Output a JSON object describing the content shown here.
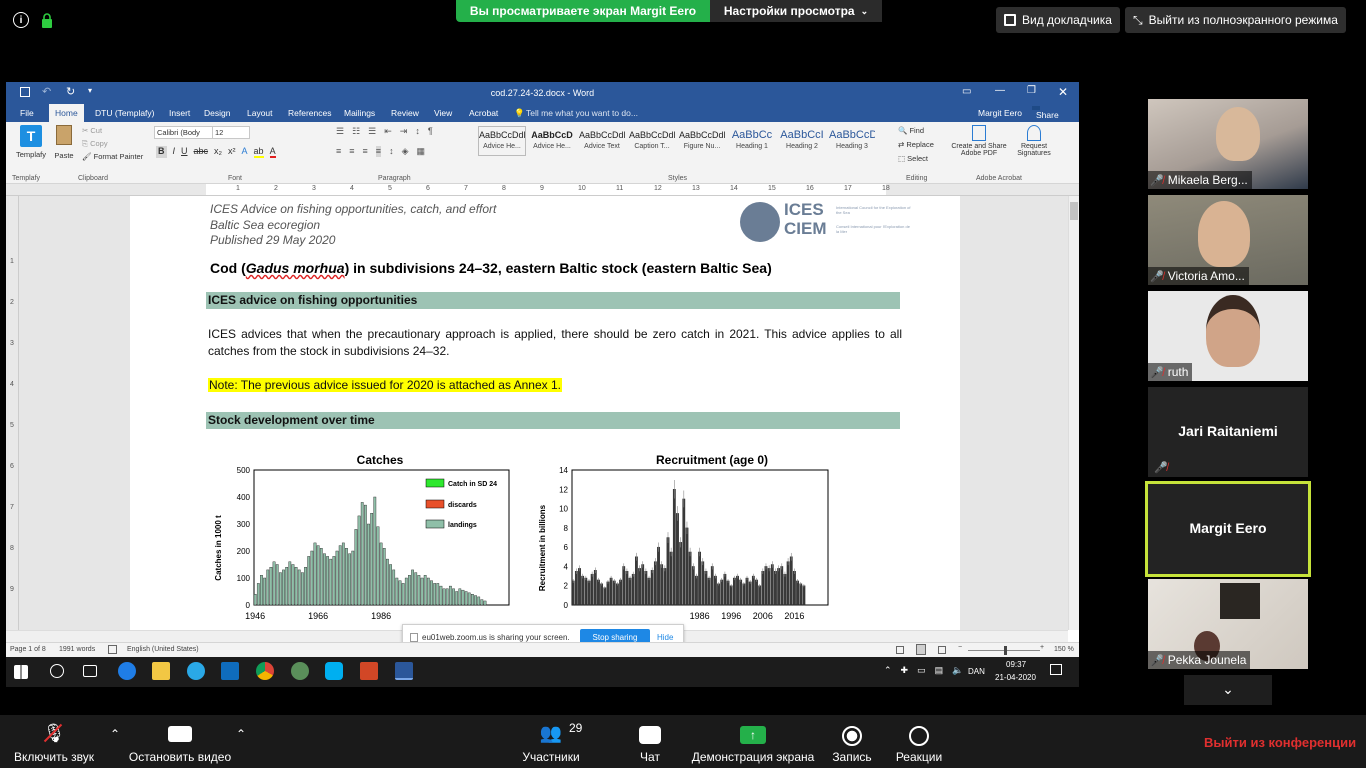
{
  "zoom_top": {
    "share_banner": "Вы просматриваете экран Margit Eero",
    "view_settings": "Настройки просмотра",
    "speaker_view": "Вид докладчика",
    "exit_fullscreen": "Выйти из полноэкранного режима"
  },
  "word": {
    "title": "cod.27.24-32.docx - Word",
    "user": "Margit Eero",
    "share": "Share",
    "tabs": [
      "File",
      "Home",
      "DTU (Templafy)",
      "Insert",
      "Design",
      "Layout",
      "References",
      "Mailings",
      "Review",
      "View",
      "Acrobat"
    ],
    "tell_me": "Tell me what you want to do...",
    "ribbon": {
      "templafy_label": "Templafy",
      "templafy_group": "Templafy",
      "paste": "Paste",
      "cut": "Cut",
      "copy": "Copy",
      "format_painter": "Format Painter",
      "clipboard_group": "Clipboard",
      "font_name": "Calibri (Body",
      "font_size": "12",
      "font_group": "Font",
      "paragraph_group": "Paragraph",
      "styles_group": "Styles",
      "styles": [
        {
          "sample": "AaBbCcDdEe",
          "name": "Advice He..."
        },
        {
          "sample": "AaBbCcD",
          "name": "Advice He..."
        },
        {
          "sample": "AaBbCcDdE",
          "name": "Advice Text"
        },
        {
          "sample": "AaBbCcDdEe",
          "name": "Caption T..."
        },
        {
          "sample": "AaBbCcDdEe",
          "name": "Figure Nu..."
        },
        {
          "sample": "AaBbCc",
          "name": "Heading 1"
        },
        {
          "sample": "AaBbCcI",
          "name": "Heading 2"
        },
        {
          "sample": "AaBbCcD",
          "name": "Heading 3"
        }
      ],
      "find": "Find",
      "replace": "Replace",
      "select": "Select",
      "editing_group": "Editing",
      "create_pdf": "Create and Share Adobe PDF",
      "request_sig": "Request Signatures",
      "acrobat_group": "Adobe Acrobat"
    },
    "ruler_numbers": [
      "1",
      "2",
      "3",
      "4",
      "5",
      "6",
      "7",
      "8",
      "9",
      "10",
      "11",
      "12",
      "13",
      "14",
      "15",
      "16",
      "17",
      "18"
    ],
    "vruler_numbers": [
      "1",
      "2",
      "3",
      "4",
      "5",
      "6",
      "7",
      "8",
      "9"
    ],
    "doc": {
      "header1": "ICES Advice on fishing opportunities, catch, and effort",
      "header2": "Baltic Sea ecoregion",
      "header3": "Published 29 May 2020",
      "logo_text": "ICES",
      "logo_text2": "CIEM",
      "logo_sub1": "International Council for the Exploration of the Sea",
      "logo_sub2": "Conseil International pour l'Exploration de la Mer",
      "title_pre": "Cod (",
      "title_italic": "Gadus morhua",
      "title_post": ") in subdivisions 24–32, eastern Baltic stock (eastern Baltic Sea)",
      "section1": "ICES advice on fishing opportunities",
      "advice": "ICES advices that when the precautionary approach is applied, there should be zero catch in 2021. This advice applies to all catches from the stock in subdivisions 24–32.",
      "note": "Note: The previous advice issued for 2020 is attached as Annex 1.",
      "section2": "Stock development over time"
    },
    "charts": [
      {
        "type": "bar",
        "title": "Catches",
        "ylabel": "Catches in 1000 t",
        "yticks": [
          "0",
          "100",
          "200",
          "300",
          "400",
          "500"
        ],
        "ylim": [
          0,
          500
        ],
        "xticks": [
          "1946",
          "1966",
          "1986"
        ],
        "legend": [
          "Catch in SD 24",
          "discards",
          "landings"
        ],
        "legend_colors": [
          "#2ee82e",
          "#e8502a",
          "#8fbfa8"
        ],
        "x": [
          1946,
          1947,
          1948,
          1949,
          1950,
          1951,
          1952,
          1953,
          1954,
          1955,
          1956,
          1957,
          1958,
          1959,
          1960,
          1961,
          1962,
          1963,
          1964,
          1965,
          1966,
          1967,
          1968,
          1969,
          1970,
          1971,
          1972,
          1973,
          1974,
          1975,
          1976,
          1977,
          1978,
          1979,
          1980,
          1981,
          1982,
          1983,
          1984,
          1985,
          1986,
          1987,
          1988,
          1989,
          1990,
          1991,
          1992,
          1993,
          1994,
          1995,
          1996,
          1997,
          1998,
          1999,
          2000,
          2001,
          2002,
          2003,
          2004,
          2005,
          2006,
          2007,
          2008,
          2009,
          2010,
          2011,
          2012,
          2013,
          2014,
          2015,
          2016,
          2017,
          2018,
          2019
        ],
        "values": [
          40,
          80,
          110,
          100,
          130,
          140,
          160,
          150,
          120,
          130,
          140,
          160,
          150,
          140,
          130,
          120,
          140,
          180,
          200,
          230,
          220,
          210,
          190,
          180,
          170,
          180,
          200,
          220,
          230,
          210,
          190,
          200,
          280,
          330,
          380,
          370,
          300,
          340,
          400,
          290,
          230,
          210,
          170,
          150,
          130,
          100,
          90,
          80,
          100,
          110,
          130,
          120,
          110,
          100,
          110,
          100,
          90,
          80,
          80,
          70,
          60,
          60,
          70,
          60,
          50,
          60,
          55,
          50,
          45,
          40,
          35,
          30,
          20,
          15
        ]
      },
      {
        "type": "bar",
        "title": "Recruitment (age 0)",
        "ylabel": "Recruitment in billions",
        "yticks": [
          "0",
          "2",
          "4",
          "6",
          "8",
          "10",
          "12",
          "14"
        ],
        "ylim": [
          0,
          14
        ],
        "xticks": [
          "1986",
          "1996",
          "2006",
          "2016"
        ],
        "x": [
          1946,
          1947,
          1948,
          1949,
          1950,
          1951,
          1952,
          1953,
          1954,
          1955,
          1956,
          1957,
          1958,
          1959,
          1960,
          1961,
          1962,
          1963,
          1964,
          1965,
          1966,
          1967,
          1968,
          1969,
          1970,
          1971,
          1972,
          1973,
          1974,
          1975,
          1976,
          1977,
          1978,
          1979,
          1980,
          1981,
          1982,
          1983,
          1984,
          1985,
          1986,
          1987,
          1988,
          1989,
          1990,
          1991,
          1992,
          1993,
          1994,
          1995,
          1996,
          1997,
          1998,
          1999,
          2000,
          2001,
          2002,
          2003,
          2004,
          2005,
          2006,
          2007,
          2008,
          2009,
          2010,
          2011,
          2012,
          2013,
          2014,
          2015,
          2016,
          2017,
          2018,
          2019
        ],
        "values": [
          2.5,
          3.5,
          3.8,
          3.0,
          2.8,
          2.5,
          3.2,
          3.6,
          2.6,
          2.2,
          1.8,
          2.4,
          2.8,
          2.5,
          2.2,
          2.6,
          4.0,
          3.5,
          2.8,
          3.2,
          5.0,
          3.8,
          4.2,
          3.5,
          2.8,
          3.6,
          4.5,
          6.0,
          4.2,
          3.8,
          7.0,
          5.5,
          12.0,
          9.5,
          6.5,
          11.0,
          8.0,
          5.5,
          4.0,
          3.0,
          5.5,
          4.5,
          3.5,
          2.8,
          4.0,
          3.0,
          2.2,
          2.6,
          3.2,
          2.5,
          2.0,
          2.8,
          3.0,
          2.6,
          2.2,
          2.8,
          2.4,
          3.0,
          2.6,
          2.0,
          3.5,
          4.0,
          3.8,
          4.2,
          3.5,
          3.8,
          4.0,
          3.2,
          4.5,
          5.0,
          3.5,
          2.5,
          2.2,
          2.0
        ]
      }
    ],
    "status": {
      "page": "Page 1 of 8",
      "words": "1991 words",
      "lang": "English (United States)",
      "zoom": "150 %"
    },
    "zoom_share": {
      "text": "eu01web.zoom.us is sharing your screen.",
      "stop": "Stop sharing",
      "hide": "Hide"
    }
  },
  "taskbar": {
    "lang": "DAN",
    "time": "09:37",
    "date": "21-04-2020"
  },
  "participants_panel": [
    {
      "name": "Mikaela Berg...",
      "muted": true,
      "video": true
    },
    {
      "name": "Victoria Amo...",
      "muted": true,
      "video": true
    },
    {
      "name": "ruth",
      "muted": true,
      "video": true
    },
    {
      "name": "Jari Raitaniemi",
      "muted": true,
      "video": false
    },
    {
      "name": "Margit Eero",
      "muted": false,
      "video": false,
      "active": true
    },
    {
      "name": "Pekka Jounela",
      "muted": true,
      "video": true
    }
  ],
  "zoom_bottom": {
    "unmute": "Включить звук",
    "stop_video": "Остановить видео",
    "participants": "Участники",
    "participants_count": "29",
    "chat": "Чат",
    "share_screen": "Демонстрация экрана",
    "record": "Запись",
    "reactions": "Реакции",
    "leave": "Выйти из конференции"
  },
  "colors": {
    "word_blue": "#2b579a",
    "zoom_green": "#24b04a",
    "section_green": "#9dc3b4",
    "note_yellow": "#ffff00",
    "active_speaker": "#c6e33a",
    "leave_red": "#e02f2f"
  }
}
